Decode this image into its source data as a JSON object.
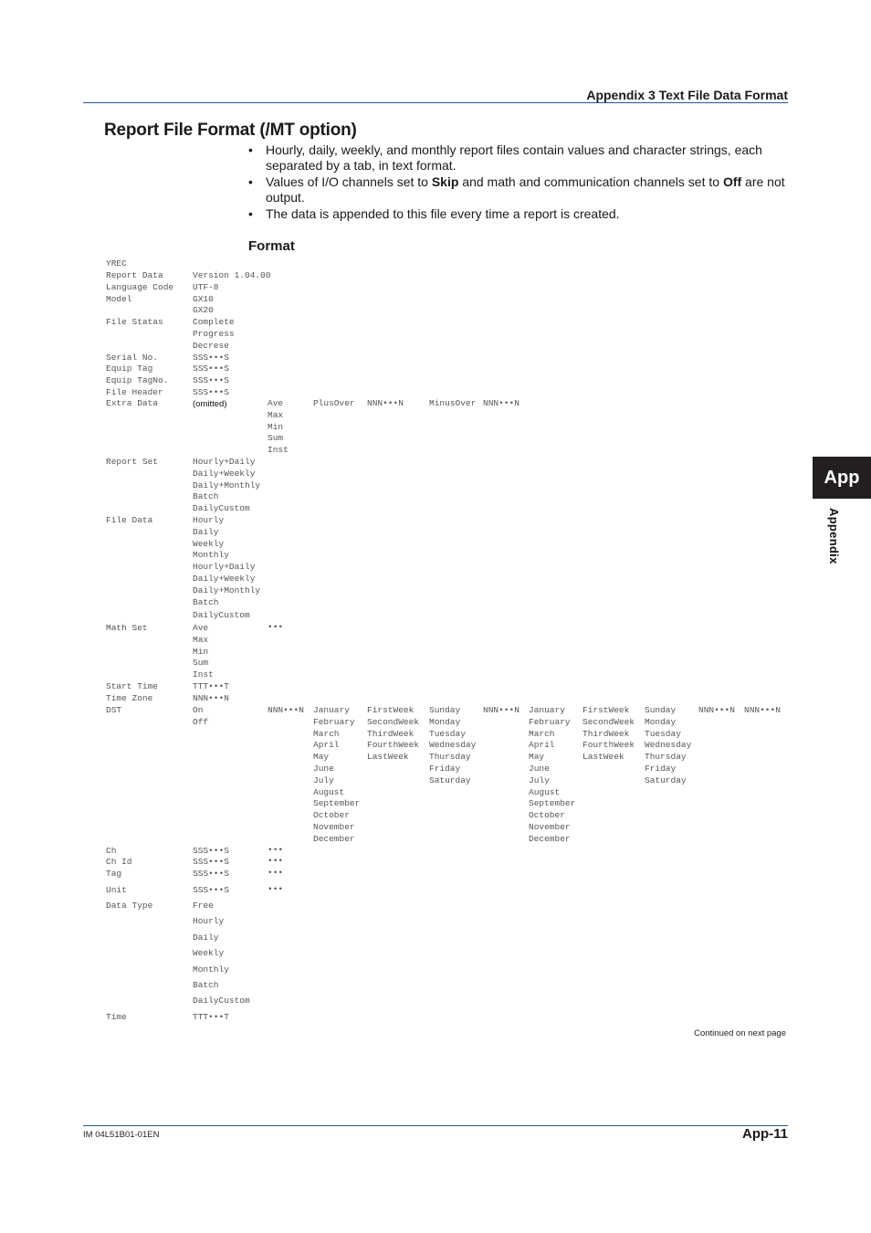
{
  "header": {
    "section": "Appendix 3 Text File Data Format"
  },
  "title": "Report File Format (/MT option)",
  "bullets": [
    {
      "parts": [
        {
          "t": "Hourly, daily, weekly, and monthly report files contain values and character strings, each separated by a tab, in text format.",
          "b": false
        }
      ]
    },
    {
      "parts": [
        {
          "t": "Values of I/O channels set to ",
          "b": false
        },
        {
          "t": "Skip",
          "b": true
        },
        {
          "t": " and math and communication channels set to ",
          "b": false
        },
        {
          "t": "Off",
          "b": true
        },
        {
          "t": " are not output.",
          "b": false
        }
      ]
    },
    {
      "parts": [
        {
          "t": "The data is appended to this file every time a report is created.",
          "b": false
        }
      ]
    }
  ],
  "format_heading": "Format",
  "format": {
    "header_row": "YREC",
    "rows": [
      {
        "key": "Report Data",
        "values": [
          "Version 1.04.00"
        ]
      },
      {
        "key": "Language Code",
        "values": [
          "UTF-8"
        ]
      },
      {
        "key": "Model",
        "values": [
          "GX10",
          "GX20"
        ]
      },
      {
        "key": "File Statas",
        "values": [
          "Complete",
          "Progress",
          "Decrese"
        ]
      },
      {
        "key": "Serial No.",
        "values": [
          "SSS•••S"
        ]
      },
      {
        "key": "Equip Tag",
        "values": [
          "SSS•••S"
        ]
      },
      {
        "key": "Equip TagNo.",
        "values": [
          "SSS•••S"
        ]
      },
      {
        "key": "File Header",
        "values": [
          "SSS•••S"
        ]
      }
    ],
    "extra_data": {
      "key": "Extra Data",
      "omitted": "(omitted)",
      "types": [
        "Ave",
        "Max",
        "Min",
        "Sum",
        "Inst"
      ],
      "plus_label": "PlusOver",
      "plus_value": "NNN•••N",
      "minus_label": "MinusOver",
      "minus_value": "NNN•••N"
    },
    "report_set": {
      "key": "Report Set",
      "values": [
        "Hourly+Daily",
        "Daily+Weekly",
        "Daily+Monthly",
        "Batch",
        "DailyCustom"
      ]
    },
    "file_data": {
      "key": "File Data",
      "values": [
        "Hourly",
        "Daily",
        "Weekly",
        "Monthly",
        "Hourly+Daily",
        "Daily+Weekly",
        "Daily+Monthly",
        "Batch",
        "DailyCustom"
      ]
    },
    "math_set": {
      "key": "Math Set",
      "values": [
        "Ave",
        "Max",
        "Min",
        "Sum",
        "Inst"
      ],
      "ellipsis": "•••"
    },
    "start_time": {
      "key": "Start Time",
      "value": "TTT•••T"
    },
    "time_zone": {
      "key": "Time Zone",
      "value": "NNN•••N"
    },
    "dst": {
      "key": "DST",
      "values": [
        "On",
        "Off"
      ],
      "offset1": "NNN•••N",
      "months": [
        "January",
        "February",
        "March",
        "April",
        "May",
        "June",
        "July",
        "August",
        "September",
        "October",
        "November",
        "December"
      ],
      "weeks": [
        "FirstWeek",
        "SecondWeek",
        "ThirdWeek",
        "FourthWeek",
        "LastWeek"
      ],
      "days": [
        "Sunday",
        "Monday",
        "Tuesday",
        "Wednesday",
        "Thursday",
        "Friday",
        "Saturday"
      ],
      "offset2": "NNN•••N",
      "offset3": "NNN•••N",
      "offset4": "NNN•••N"
    },
    "channel_rows": [
      {
        "key": "Ch",
        "value": "SSS•••S",
        "ellipsis": "•••"
      },
      {
        "key": "Ch Id",
        "value": "SSS•••S",
        "ellipsis": "•••"
      },
      {
        "key": "Tag",
        "value": "SSS•••S",
        "ellipsis": "•••"
      },
      {
        "key": "Unit",
        "value": "SSS•••S",
        "ellipsis": "•••"
      }
    ],
    "data_type": {
      "key": "Data Type",
      "values": [
        "Free",
        "Hourly",
        "Daily",
        "Weekly",
        "Monthly",
        "Batch",
        "DailyCustom"
      ]
    },
    "time": {
      "key": "Time",
      "value": "TTT•••T"
    }
  },
  "continued": "Continued on next page",
  "footer": {
    "doc_id": "IM 04L51B01-01EN",
    "page": "App-11"
  },
  "side_tab": {
    "label": "App",
    "vertical": "Appendix"
  }
}
